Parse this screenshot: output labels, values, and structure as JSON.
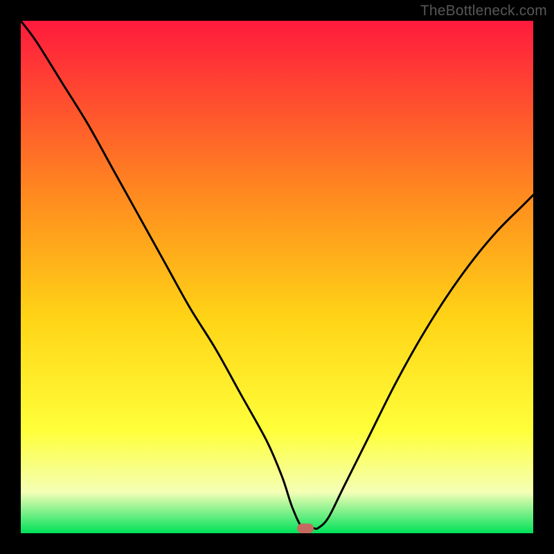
{
  "watermark": "TheBottleneck.com",
  "colors": {
    "top": "#ff1a3d",
    "mid_upper": "#ff8a1f",
    "mid": "#ffd416",
    "mid_lower": "#ffff3a",
    "pale": "#f4ffb5",
    "bottom": "#00e15a",
    "curve": "#000000",
    "marker": "#c56a60",
    "frame": "#000000"
  },
  "chart_data": {
    "type": "line",
    "title": "",
    "xlabel": "",
    "ylabel": "",
    "xlim": [
      0,
      100
    ],
    "ylim": [
      0,
      100
    ],
    "grid": false,
    "legend": false,
    "curve_comment": "y-values estimated from pixel positions; 0 = bottom (green), 100 = top (red). Curve resembles a bottleneck V with minimum around x≈55.",
    "x": [
      0,
      3,
      8,
      13,
      18,
      23,
      28,
      33,
      38,
      43,
      48,
      51,
      53,
      55,
      57,
      58,
      60,
      63,
      68,
      73,
      78,
      83,
      88,
      93,
      98,
      100
    ],
    "y": [
      100,
      96,
      88,
      80,
      71,
      62,
      53,
      44,
      36,
      27,
      18,
      11,
      5,
      1,
      1,
      1,
      3,
      9,
      19,
      29,
      38,
      46,
      53,
      59,
      64,
      66
    ],
    "marker": {
      "x": 55.5,
      "y": 1
    }
  }
}
